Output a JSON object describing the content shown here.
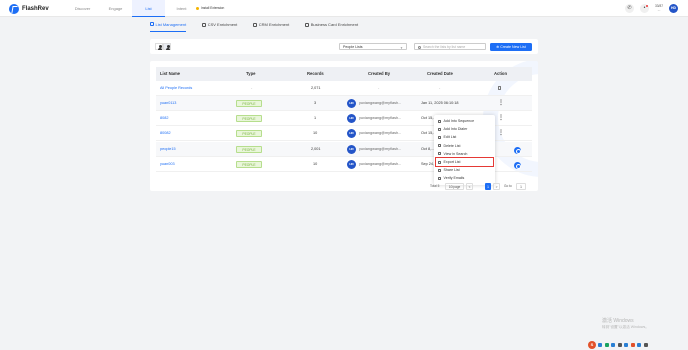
{
  "app": {
    "logo_text": "FlashRev"
  },
  "nav": [
    "Discover",
    "Engage",
    "List",
    "Intent"
  ],
  "install_extension": "Install Extension",
  "credits": {
    "line1": "33/87",
    "line2": "..."
  },
  "user_initials": "HD",
  "subtabs": [
    "List Management",
    "CSV Enrichment",
    "CRM Enrichment",
    "Business Card Enrichment"
  ],
  "toolbar": {
    "type_select": "People Lists",
    "search_placeholder": "Search the lists by list name",
    "new_list_label": "Create New List"
  },
  "table": {
    "headers": [
      "List Name",
      "Type",
      "Records",
      "Created By",
      "Created Date",
      "Action"
    ],
    "rows": [
      {
        "name": "All People Records",
        "type": "-",
        "records": "2,071",
        "created_by": "-",
        "date": "-"
      },
      {
        "name": "yuan0113",
        "type": "PEOPLE",
        "records": "3",
        "created_by": "yuxiangwang@myflash...",
        "date": "Jan 11, 2025 06:10:18"
      },
      {
        "name": "8082",
        "type": "PEOPLE",
        "records": "1",
        "created_by": "yuxiangwang@myflash...",
        "date": "Oct 15,..."
      },
      {
        "name": "80082",
        "type": "PEOPLE",
        "records": "10",
        "created_by": "yuxiangwang@myflash...",
        "date": "Oct 15,..."
      },
      {
        "name": "people15",
        "type": "PEOPLE",
        "records": "2,001",
        "created_by": "yuxiangwang@myflash...",
        "date": "Oct 8,..."
      },
      {
        "name": "yuan003",
        "type": "PEOPLE",
        "records": "10",
        "created_by": "yuxiangwang@myflash...",
        "date": "Sep 24,..."
      }
    ],
    "avatar_initials": "HD"
  },
  "menu": [
    "Add Into Sequence",
    "Add Into Dialer",
    "Edit List",
    "Delete List",
    "View in Search",
    "Export List",
    "Share List",
    "Verify Emails"
  ],
  "pagination": {
    "total": "Total 5",
    "per_page": "10/page",
    "prev": "<",
    "current": "1",
    "next": ">",
    "goto": "Go to",
    "goto_value": "1"
  },
  "watermark": {
    "line1": "激活 Windows",
    "line2": "转到\"设置\"以激活 Windows。"
  },
  "tray": {
    "ime": "S"
  }
}
